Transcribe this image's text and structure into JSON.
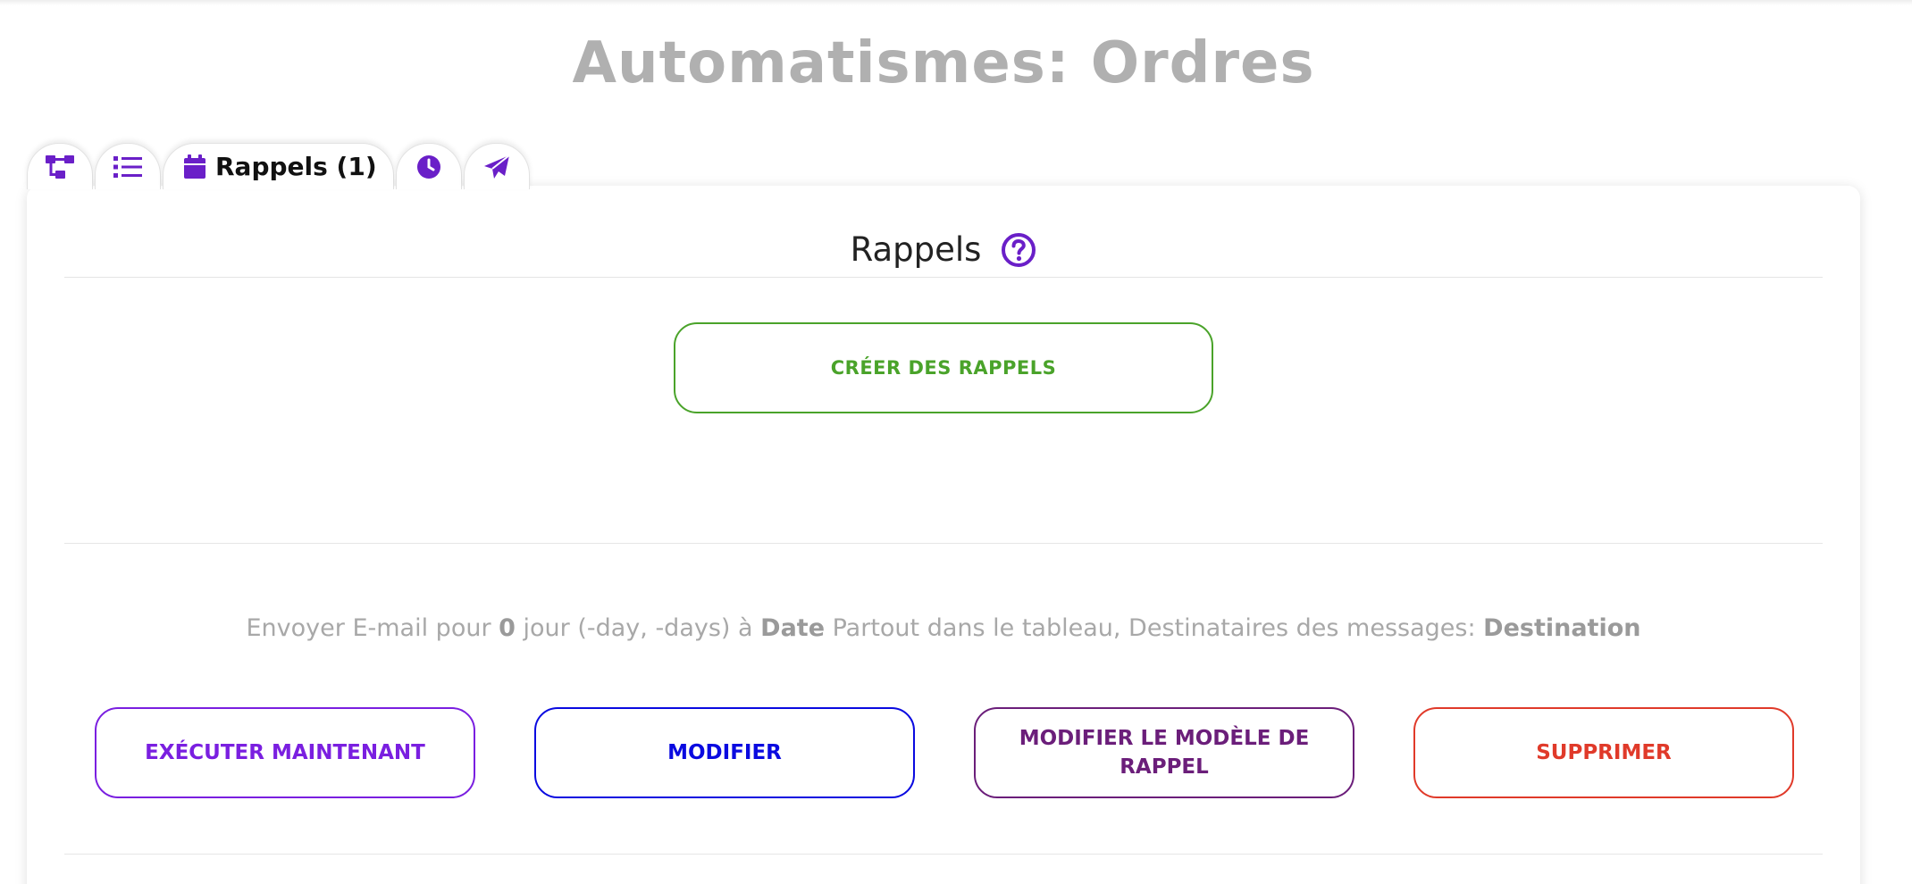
{
  "page": {
    "title": "Automatismes: Ordres"
  },
  "tabs": [
    {
      "icon": "sitemap-icon"
    },
    {
      "icon": "list-icon"
    },
    {
      "icon": "calendar-icon",
      "label": "Rappels (1)"
    },
    {
      "icon": "clock-icon"
    },
    {
      "icon": "paper-plane-icon"
    }
  ],
  "section": {
    "title": "Rappels",
    "help_icon": "question-circle-icon",
    "create_button": "CRÉER DES RAPPELS"
  },
  "reminder": {
    "prefix": "Envoyer E-mail pour ",
    "days": "0",
    "mid1": " jour (-day, -days) à ",
    "date_field": "Date",
    "mid2": " Partout dans le tableau, Destinataires des messages: ",
    "recipient": "Destination",
    "actions": {
      "run_now": "EXÉCUTER MAINTENANT",
      "edit": "MODIFIER",
      "edit_template": "MODIFIER LE MODÈLE DE RAPPEL",
      "delete": "SUPPRIMER"
    }
  },
  "colors": {
    "accent": "#6a1fc8",
    "title_gray": "#b0b0b0",
    "green": "#4aa32a",
    "violet": "#7a1fe0",
    "blue": "#0a0ae0",
    "plum": "#6b1e7a",
    "red": "#e03a2a"
  }
}
